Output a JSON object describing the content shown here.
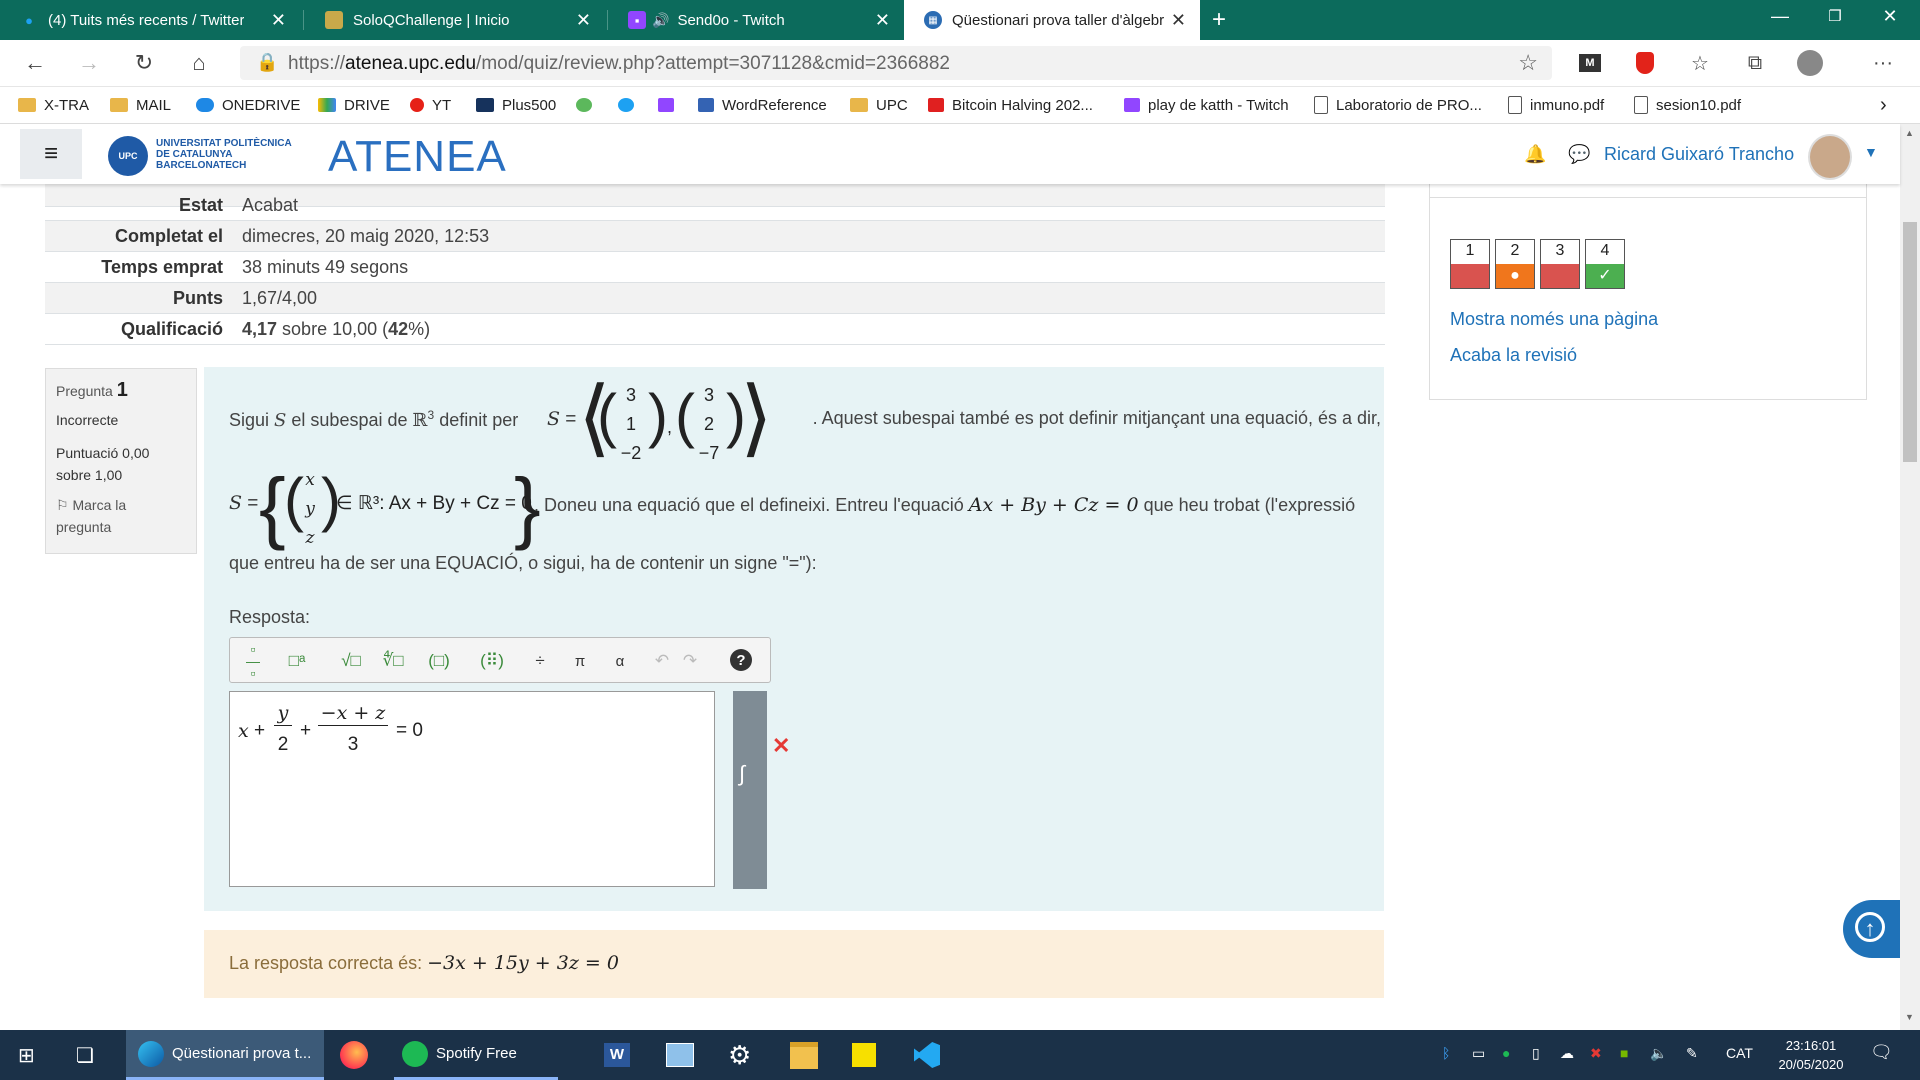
{
  "browser": {
    "tabs": [
      {
        "title": "(4) Tuits més recents / Twitter",
        "icon": "twitter-icon"
      },
      {
        "title": "SoloQChallenge | Inicio",
        "icon": "soloq-icon"
      },
      {
        "title": "Send0o - Twitch",
        "icon": "twitch-icon",
        "audio": true
      },
      {
        "title": "Qüestionari prova taller d'àlgebr",
        "icon": "atenea-icon",
        "active": true
      }
    ],
    "url": {
      "scheme": "https://",
      "host": "atenea.upc.edu",
      "path": "/mod/quiz/review.php?attempt=3071128&cmid=2366882"
    },
    "bookmarks": [
      {
        "label": "X-TRA",
        "icon": "folder-icon"
      },
      {
        "label": "MAIL",
        "icon": "folder-icon"
      },
      {
        "label": "ONEDRIVE",
        "icon": "onedrive-icon"
      },
      {
        "label": "DRIVE",
        "icon": "drive-icon"
      },
      {
        "label": "YT",
        "icon": "youtube-icon"
      },
      {
        "label": "Plus500",
        "icon": "plus500-icon"
      },
      {
        "label": "",
        "icon": "green-icon"
      },
      {
        "label": "",
        "icon": "twitter-icon"
      },
      {
        "label": "",
        "icon": "twitch-icon"
      },
      {
        "label": "WordReference",
        "icon": "wordreference-icon"
      },
      {
        "label": "UPC",
        "icon": "folder-icon"
      },
      {
        "label": "Bitcoin Halving 202...",
        "icon": "ig-icon"
      },
      {
        "label": "play de katth - Twitch",
        "icon": "twitch-icon"
      },
      {
        "label": "Laboratorio de PRO...",
        "icon": "page-icon"
      },
      {
        "label": "inmuno.pdf",
        "icon": "page-icon"
      },
      {
        "label": "sesion10.pdf",
        "icon": "page-icon"
      }
    ]
  },
  "site": {
    "university": "UNIVERSITAT POLITÈCNICA DE CATALUNYA BARCELONATECH",
    "logo_small": "UPC",
    "brand": "ATENEA",
    "user_name": "Ricard Guixaró Trancho"
  },
  "summary": [
    {
      "label": "Estat",
      "value": "Acabat"
    },
    {
      "label": "Completat el",
      "value": "dimecres, 20 maig 2020, 12:53"
    },
    {
      "label": "Temps emprat",
      "value": "38 minuts 49 segons"
    },
    {
      "label": "Punts",
      "value": "1,67/4,00"
    },
    {
      "label": "Qualificació",
      "value_parts": [
        "4,17",
        " sobre 10,00 (",
        "42",
        "%)"
      ]
    }
  ],
  "question": {
    "label": "Pregunta",
    "number": "1",
    "status": "Incorrecte",
    "score_line1": "Puntuació 0,00",
    "score_line2": "sobre 1,00",
    "flag_line1": "Marca la",
    "flag_line2": "pregunta",
    "text_a": "Sigui",
    "text_b": "el subespai de",
    "text_c": "definit per",
    "text_d": ". Aquest subespai també es pot definir mitjançant una equació, és a dir,",
    "text_e": ". Doneu una equació que el defineixi. Entreu l'equació",
    "text_f": "que heu trobat (l'expressió",
    "text_g": "que entreu ha de ser una EQUACIÓ, o sigui, ha de contenir un signe \"=\"):",
    "var_S": "S",
    "set_R3": "ℝ",
    "sup3": "3",
    "vector1": [
      "3",
      "1",
      "−2"
    ],
    "vector2": [
      "3",
      "2",
      "−7"
    ],
    "vector_xyz": [
      "x",
      "y",
      "z"
    ],
    "set_condition": "∈ ℝ³: Ax + By + Cz = 0",
    "equation": "Ax + By + Cz = 0",
    "answer_label": "Resposta:",
    "answer_parts": {
      "x": "x",
      "plus": "+",
      "y": "y",
      "two": "2",
      "num": "−x + z",
      "three": "3",
      "eq": "= 0"
    },
    "correct_label": "La resposta correcta és:",
    "correct_answer": "−3x + 15y + 3z = 0"
  },
  "toolbar": [
    "fraction",
    "superscript",
    "sqrt",
    "nth-root",
    "parentheses",
    "matrix",
    "divide",
    "π",
    "α",
    "undo",
    "redo",
    "help"
  ],
  "toolbar_glyphs": {
    "divide": "÷",
    "pi": "π",
    "alpha": "α",
    "help": "?"
  },
  "navigation": {
    "questions": [
      {
        "num": "1",
        "state": "incorrect",
        "color": "#d9534f"
      },
      {
        "num": "2",
        "state": "partial",
        "color": "#f0761c"
      },
      {
        "num": "3",
        "state": "incorrect",
        "color": "#d9534f"
      },
      {
        "num": "4",
        "state": "correct",
        "color": "#4caf50"
      }
    ],
    "show_one_page": "Mostra només una pàgina",
    "finish_review": "Acaba la revisió"
  },
  "taskbar": {
    "apps": [
      {
        "label": "Qüestionari prova t...",
        "icon": "edge-icon"
      },
      {
        "label": "",
        "icon": "firefox-icon"
      },
      {
        "label": "Spotify Free",
        "icon": "spotify-icon"
      },
      {
        "label": "",
        "icon": "word-icon"
      },
      {
        "label": "",
        "icon": "settings-icon"
      },
      {
        "label": "",
        "icon": "explorer-icon"
      },
      {
        "label": "",
        "icon": "sticky-notes-icon"
      },
      {
        "label": "",
        "icon": "vscode-icon"
      }
    ],
    "language": "CAT",
    "time": "23:16:01",
    "date": "20/05/2020"
  }
}
